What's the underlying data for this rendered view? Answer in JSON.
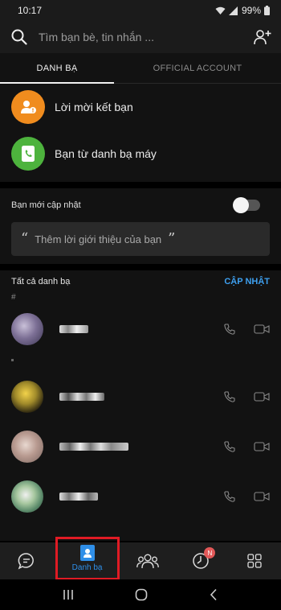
{
  "status": {
    "time": "10:17",
    "battery": "99%"
  },
  "search": {
    "placeholder": "Tìm bạn bè, tin nhắn ..."
  },
  "tabs": [
    {
      "label": "DANH BẠ",
      "active": true
    },
    {
      "label": "OFFICIAL ACCOUNT",
      "active": false
    }
  ],
  "actions": [
    {
      "label": "Lời mời kết bạn",
      "icon": "friend-request-icon",
      "color": "#f08c1e"
    },
    {
      "label": "Bạn từ danh bạ máy",
      "icon": "phone-contacts-icon",
      "color": "#4db33d"
    }
  ],
  "new_update": {
    "label": "Bạn mới cập nhật",
    "toggle_on": false
  },
  "intro": {
    "open_quote": "“",
    "text": "Thêm lời giới thiệu của bạn",
    "close_quote": "”"
  },
  "contacts_section": {
    "title": "Tất cả danh bạ",
    "update_label": "CẬP NHẬT",
    "group_letter": "#"
  },
  "bottom_nav": {
    "active_label": "Danh bạ",
    "badge": "N",
    "accent": "#2f8fe8",
    "highlight": "#e01b24"
  }
}
